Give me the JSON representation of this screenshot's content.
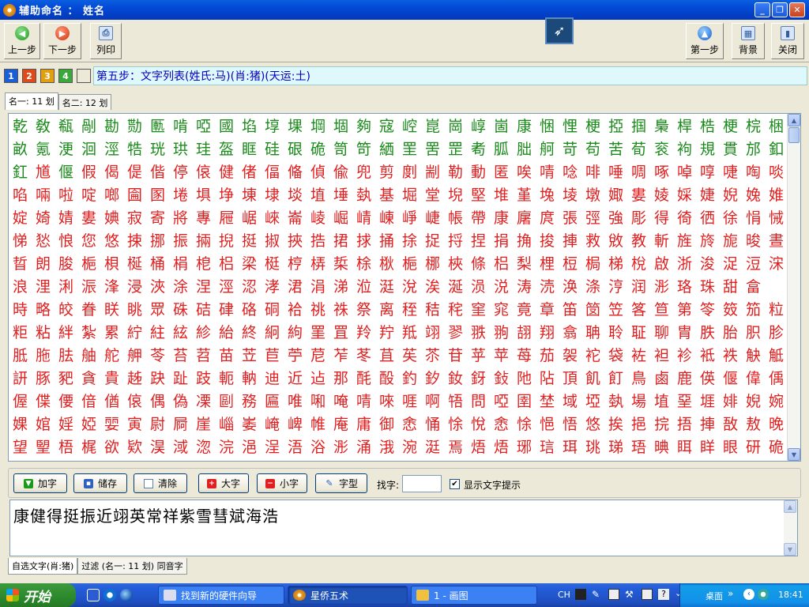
{
  "window": {
    "title": "辅助命名 ： 姓名"
  },
  "toolbar": {
    "prev_label": "上一步",
    "next_label": "下一步",
    "print_label": "列印",
    "first_label": "第一步",
    "bg_label": "背景",
    "close_label": "关闭"
  },
  "steps": {
    "buttons": [
      "1",
      "2",
      "3",
      "4",
      ""
    ],
    "colors": [
      "#1a5fd8",
      "#e04a1a",
      "#e0a010",
      "#3aa83a",
      "#ece9d8"
    ],
    "info": "第五步：文字列表(姓氏:马)(肖:猪)(天运:土)"
  },
  "tabs_top": [
    "名一: 11 划",
    "名二: 12 划"
  ],
  "grid": {
    "green": "#1a8a1a",
    "red": "#e02020",
    "black": "#202020",
    "rows": [
      {
        "c": "乾敎瓻剮勘勚匭啃啞國埳埻堁堈堌夠寇崆崑崗崞崮康悃悝梗掗掴梟桿梏梗梡梱",
        "k": "GGGGGGGGGGGGGGGGGGGGGGGGGGGGGGGGGG"
      },
      {
        "c": "畝氪浭洄涇牿珖珙珪盔眶硅硍硊笥笴絤罜罟罡耇胍胐舸苛苟苦荀衮袧規貫邡釦",
        "k": "GGGGGGGGGGGGGGGGGGGGGGGGGGGGGGGGGG"
      },
      {
        "c": "釭馗偃假偈偍偕停偯健偖偪偹偵偸兜剪剫剬勒動匿唉啨唸啡唾啁啄啅啍啑啕啖",
        "k": "GRGRRRRRRRRRRRRRRRRRRRRRRRRRRRRRRR"
      },
      {
        "c": "啗啢啦啶啷圇圂埢埧埩埬埭埮埴埵埶基堀堂堄堅堆堇堍堎墩娵婁婈婇婕婗婏婎",
        "k": "RRRRRRRRRRRRRRRRRRRRRRRRRRRRRRRRRR"
      },
      {
        "c": "婝婍婧婁婰寂寄將專屜崌崍崙崚崛崝崠崢崨帳帶康廜庹張弳強彫得徛徆徐悁悈",
        "k": "RRRRRRRRRRRRRRRRRRRRRRRRRRRRRRRRRR"
      },
      {
        "c": "悌悐悢您悠捒挪振掚掜挺掓挾捁捃捄捅捈捉捋捏捐捔捘捙救敓教斬旌旍旎晙晝",
        "k": "RRRRRRRRRRRRRRRRRRRRRRRRRRRRRRRRRR"
      },
      {
        "c": "晢朗朘梔梖梴桶梋梎梠梁梃梈梇梊梌梑梔梛梜條梠梨梩梪梮梯梲啟浙浚浞浢浨",
        "k": "RRRRRRRRRRRRRRRRRRRRRRRRRRRRRRRRRR"
      },
      {
        "c": "浪浬浰浱浲浸浹涂涅涇涊涍涒涓涕涖涏涗涘涎涢涚涛涜涣涤涥润浵珞珠甜畣",
        "k": "RRRRRRRRRRRRRRRRRRRRRRRRRRRRRRRRRR"
      },
      {
        "c": "時略皎眷眹眺眾硃硈硉硌硐袷祧祩祭离秷秸秺窐窕竟章笛笝笠笿笪第笭笯笳粒",
        "k": "RRRRRRRRRRRRRRRRRRRRRRRRRRRRRRRRRR"
      },
      {
        "c": "粔粘絆紮累紵紸絃紾紿終絅絇罣罝羚羜羝翊翏翐翑翓翔翕聃聆聇聊胄胅胎胑胗胛",
        "k": "RRRRRRRRRRRRRRRRRRRRRRRRRRRRRRRRRR"
      },
      {
        "c": "胝胣胠舳舵舺苓苔苕苗苙苣苧苨苲苳苴苵苶苷苸苹苺茄袈袉袋袏袒袗袛袟觖觝訣訥訛",
        "k": "RRRRRRRRRRRRRRRRRRRRRRRRRRRRRRRRRR"
      },
      {
        "c": "訮豚豝貪貴趀趹趾跂軛軜迪近迠那酕酘釣釸釹釾鈙阤阽頂飢飣鳥鹵鹿偀偃偉偊偎",
        "k": "RRRRRRRRRRRRRRRRRRRRRRRRRRRRRRRRRR"
      },
      {
        "c": "偓偞偠偣偤偯偶偽凓剾務匾唯啝唵啨唻啀啊啎問啞圉埜域埡埶場埴堊堐婔婗婉",
        "k": "RRRRRRRRRRRRRRRRRRRRRRRRRRRRRRRRRR"
      },
      {
        "c": "婐婠婬婭婯寅尉屙崖崰崣崦崥帷庵庸御悆悀悇悅悆悇悒悟悠挨挹捖捂捙敔敖晚晤",
        "k": "RRRRRRRRRRRRRRRRRRRRRRRRRRRRRRRRRR"
      },
      {
        "c": "望朢梧梶欲欵淏淢淴浣浥浧浯浴浵涌涐涴涏焉焐焐琊琂珥珧珶珸晪眲眻眼研硊硛",
        "k": "RRRRRRRRRRRRRRRRRRRRRRRRRRRRRRRRRR"
      }
    ]
  },
  "actions": {
    "add_label": "加字",
    "save_label": "储存",
    "clear_label": "清除",
    "big_label": "大字",
    "small_label": "小字",
    "style_label": "字型",
    "find_label": "找字:",
    "find_value": "",
    "hint_label": "显示文字提示",
    "hint_checked": true
  },
  "selected_text": "康健得挺振近翊英常祥紫雪彗斌海浩",
  "tabs_bottom": [
    "自选文字(肖:猪)",
    "过滤 (名一: 11 划) 同音字"
  ],
  "taskbar": {
    "start_label": "开始",
    "tasks": [
      "找到新的硬件向导",
      "星侨五术",
      "1 - 画图"
    ],
    "tray_ime": "CH",
    "tray_desktop": "桌面",
    "clock": "18:41"
  }
}
